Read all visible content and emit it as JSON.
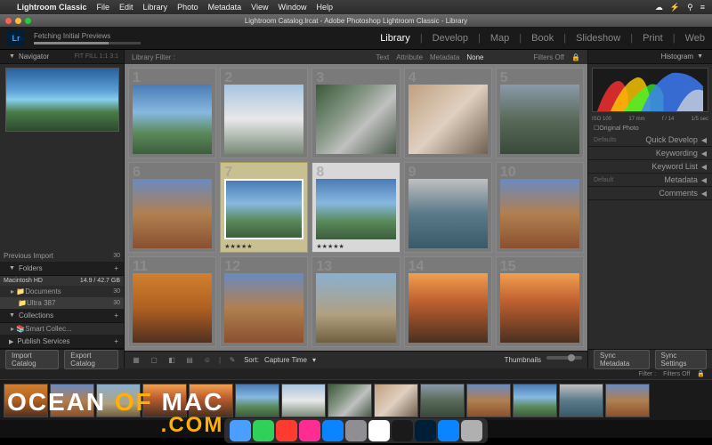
{
  "menubar": {
    "app": "Lightroom Classic",
    "items": [
      "File",
      "Edit",
      "Library",
      "Photo",
      "Metadata",
      "View",
      "Window",
      "Help"
    ]
  },
  "titlebar": {
    "title": "Lightroom Catalog.lrcat - Adobe Photoshop Lightroom Classic - Library"
  },
  "header": {
    "logo": "Lr",
    "progress_label": "Fetching Initial Previews",
    "modules": [
      "Library",
      "Develop",
      "Map",
      "Book",
      "Slideshow",
      "Print",
      "Web"
    ],
    "active_module": "Library"
  },
  "left_panel": {
    "navigator": {
      "title": "Navigator",
      "modes": "FIT   FILL   1:1   3:1"
    },
    "prev_import": {
      "label": "Previous Import",
      "count": "30"
    },
    "folders": {
      "title": "Folders",
      "volume": {
        "name": "Macintosh HD",
        "space": "14.9 / 42.7 GB"
      },
      "items": [
        {
          "name": "Documents",
          "count": "30"
        },
        {
          "name": "Ultra 387",
          "count": "30"
        }
      ]
    },
    "collections": {
      "title": "Collections",
      "items": [
        {
          "name": "Smart Collec...",
          "count": ""
        }
      ]
    },
    "publish": {
      "title": "Publish Services"
    },
    "import_btn": "Import Catalog",
    "export_btn": "Export Catalog"
  },
  "center": {
    "filter_label": "Library Filter :",
    "filter_tabs": [
      "Text",
      "Attribute",
      "Metadata",
      "None"
    ],
    "filter_active": "None",
    "filters_off": "Filters Off",
    "sort_label": "Sort:",
    "sort_value": "Capture Time",
    "thumbnails_label": "Thumbnails",
    "cells": [
      {
        "n": "1",
        "t": "th-sky"
      },
      {
        "n": "2",
        "t": "th-snow"
      },
      {
        "n": "3",
        "t": "th-wf1"
      },
      {
        "n": "4",
        "t": "th-wf2"
      },
      {
        "n": "5",
        "t": "th-wf3"
      },
      {
        "n": "6",
        "t": "th-can1"
      },
      {
        "n": "7",
        "t": "th-sky",
        "sel": true,
        "stars": "★★★★★"
      },
      {
        "n": "8",
        "t": "th-sky",
        "sup": true,
        "stars": "★★★★★"
      },
      {
        "n": "9",
        "t": "th-lk"
      },
      {
        "n": "10",
        "t": "th-can1"
      },
      {
        "n": "11",
        "t": "th-can2"
      },
      {
        "n": "12",
        "t": "th-can1"
      },
      {
        "n": "13",
        "t": "th-pl"
      },
      {
        "n": "14",
        "t": "th-mv"
      },
      {
        "n": "15",
        "t": "th-mv"
      }
    ]
  },
  "right_panel": {
    "histogram": {
      "title": "Histogram",
      "iso": "ISO 100",
      "focal": "17 mm",
      "aperture": "f / 14",
      "shutter": "1/5 sec",
      "original": "Original Photo"
    },
    "sections": [
      {
        "prefix": "Defaults",
        "label": "Quick Develop"
      },
      {
        "label": "Keywording"
      },
      {
        "label": "Keyword List"
      },
      {
        "prefix": "Default",
        "label": "Metadata"
      },
      {
        "label": "Comments"
      }
    ],
    "sync_meta": "Sync Metadata",
    "sync_set": "Sync Settings"
  },
  "filmstrip": {
    "filter_label": "Filter :",
    "filters_off": "Filters Off"
  },
  "watermark": {
    "a": "OCEAN",
    "b": "OF",
    "c": "MAC",
    "d": ".COM"
  },
  "dock_colors": [
    "#4a9eff",
    "#30d158",
    "#ff3b30",
    "#ff2d92",
    "#0a84ff",
    "#8e8e93",
    "#ffffff",
    "#1a1a1a",
    "#001e36",
    "#0a84ff",
    "#b0b0b0"
  ]
}
